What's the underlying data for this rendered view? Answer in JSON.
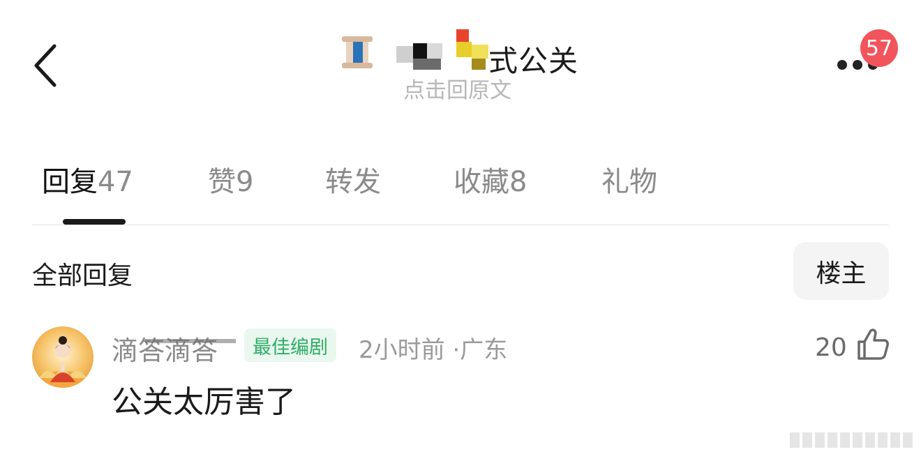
{
  "header": {
    "title": "式公关",
    "subtitle": "点击回原文",
    "notification_count": "57",
    "icons": {
      "back": "chevron-left-icon",
      "more": "more-dots-icon"
    }
  },
  "tabs": [
    {
      "label": "回复",
      "count": "47",
      "active": true
    },
    {
      "label": "赞",
      "count": "9",
      "active": false
    },
    {
      "label": "转发",
      "count": "",
      "active": false
    },
    {
      "label": "收藏",
      "count": "8",
      "active": false
    },
    {
      "label": "礼物",
      "count": "",
      "active": false
    }
  ],
  "section": {
    "title": "全部回复",
    "filter_label": "楼主"
  },
  "comment": {
    "username": "滴答滴答",
    "tag": "最佳编剧",
    "time": "2小时前",
    "location": "广东",
    "meta_separator": "·",
    "likes": "20",
    "text": "公关太厉害了",
    "icons": {
      "avatar": "avatar-image",
      "like": "thumbs-up-icon"
    }
  },
  "colors": {
    "badge": "#f2545b",
    "tag_text": "#2fae64",
    "tag_bg": "#e9f7ef",
    "muted": "#8a8a8a",
    "subtitle": "#b7b7b7"
  }
}
